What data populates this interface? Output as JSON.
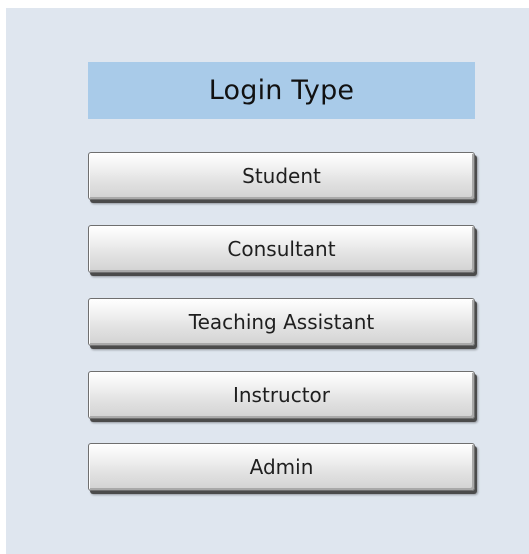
{
  "login_panel": {
    "title": "Login Type",
    "buttons": [
      {
        "label": "Student"
      },
      {
        "label": "Consultant"
      },
      {
        "label": "Teaching Assistant"
      },
      {
        "label": "Instructor"
      },
      {
        "label": "Admin"
      }
    ],
    "colors": {
      "panel_background": "#dfe6ef",
      "title_background": "#a9cbe9"
    }
  }
}
